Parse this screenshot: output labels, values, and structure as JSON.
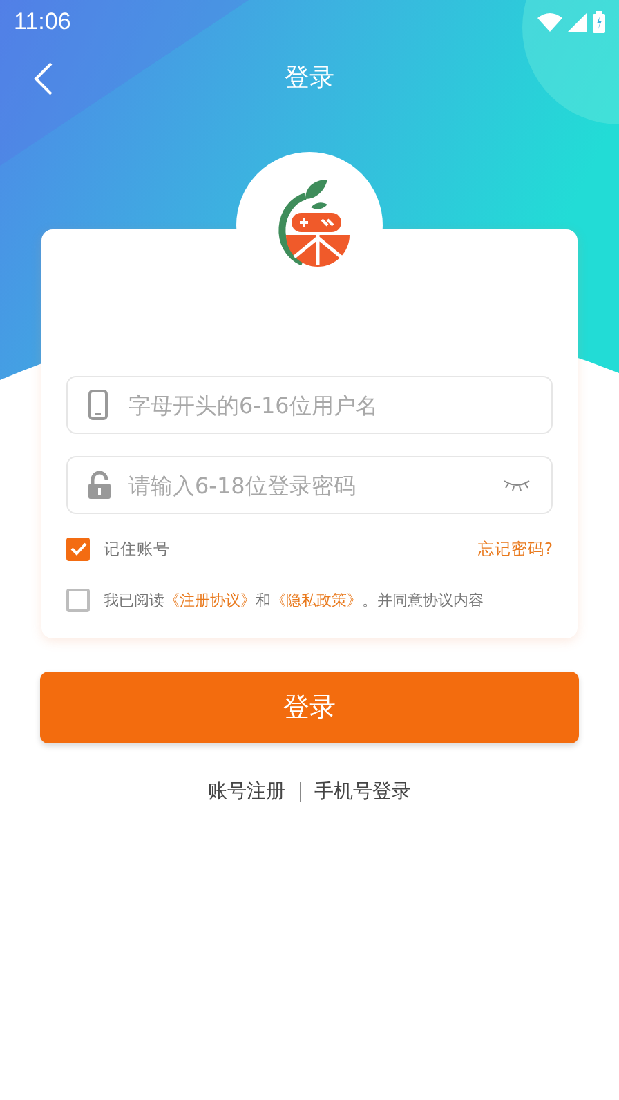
{
  "status_bar": {
    "time": "11:06"
  },
  "header": {
    "title": "登录"
  },
  "form": {
    "username": {
      "placeholder": "字母开头的6-16位用户名"
    },
    "password": {
      "placeholder": "请输入6-18位登录密码"
    },
    "remember": {
      "label": "记住账号",
      "checked": true
    },
    "forgot": "忘记密码?",
    "agreement": {
      "checked": false,
      "parts": [
        {
          "kind": "text",
          "text": "我已阅读"
        },
        {
          "kind": "link",
          "text": "《注册协议》"
        },
        {
          "kind": "text",
          "text": "和"
        },
        {
          "kind": "link",
          "text": "《隐私政策》"
        },
        {
          "kind": "text",
          "text": "。并同意协议内容"
        }
      ]
    }
  },
  "login_button": "登录",
  "links": [
    "账号注册",
    "手机号登录"
  ]
}
